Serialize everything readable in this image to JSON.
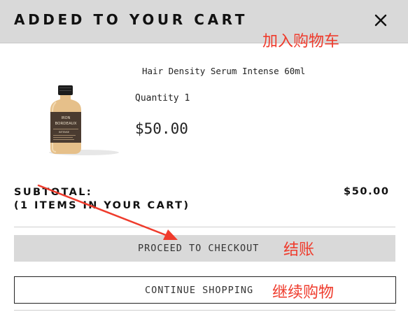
{
  "header": {
    "title": "ADDED TO YOUR CART"
  },
  "annotations": {
    "cart_note": "加入购物车",
    "checkout_note": "结账",
    "continue_note": "继续购物",
    "color": "#ef3b2c"
  },
  "item": {
    "name": "Hair Density Serum Intense 60ml",
    "quantity_text": "Quantity 1",
    "price": "$50.00",
    "image": {
      "alt": "bottle-image",
      "label_lines": [
        "IRON",
        "BORDEAUX",
        "INTENSE"
      ]
    }
  },
  "summary": {
    "subtotal_label": "SUBTOTAL:",
    "items_count_text": "(1 ITEMS IN YOUR CART)",
    "subtotal_amount": "$50.00"
  },
  "actions": {
    "checkout_label": "PROCEED TO CHECKOUT",
    "continue_label": "CONTINUE SHOPPING"
  },
  "icons": {
    "close": "close-icon",
    "annotation_arrow": "arrow-annotation"
  },
  "colors": {
    "header_bg": "#d9d9d9",
    "checkout_bg": "#d9d9d9",
    "annotation_red": "#ef3b2c"
  }
}
